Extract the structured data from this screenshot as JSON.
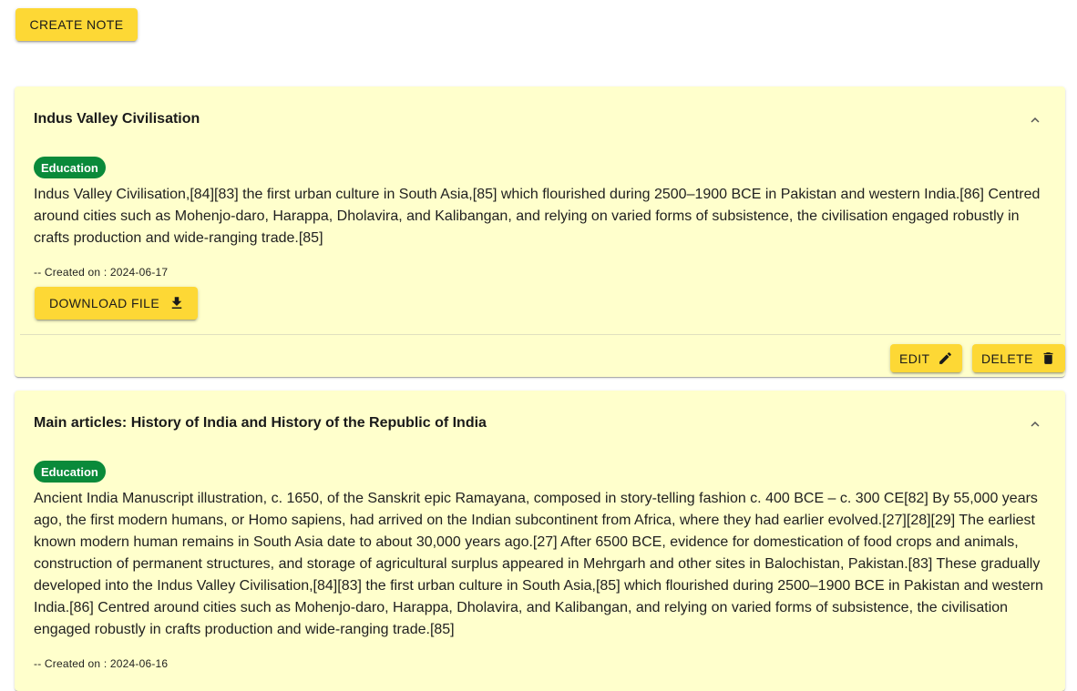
{
  "toolbar": {
    "create_label": "CREATE NOTE"
  },
  "notes": [
    {
      "title": "Indus Valley Civilisation",
      "tag": "Education",
      "body": "Indus Valley Civilisation,[84][83] the first urban culture in South Asia,[85] which flourished during 2500–1900 BCE in Pakistan and western India.[86] Centred around cities such as Mohenjo-daro, Harappa, Dholavira, and Kalibangan, and relying on varied forms of subsistence, the civilisation engaged robustly in crafts production and wide-ranging trade.[85]",
      "created": "-- Created on : 2024-06-17",
      "download_label": "DOWNLOAD FILE",
      "edit_label": "EDIT",
      "delete_label": "DELETE"
    },
    {
      "title": "Main articles: History of India and History of the Republic of India",
      "tag": "Education",
      "body": "Ancient India Manuscript illustration, c. 1650, of the Sanskrit epic Ramayana, composed in story-telling fashion c. 400 BCE – c. 300 CE[82] By 55,000 years ago, the first modern humans, or Homo sapiens, had arrived on the Indian subcontinent from Africa, where they had earlier evolved.[27][28][29] The earliest known modern human remains in South Asia date to about 30,000 years ago.[27] After 6500 BCE, evidence for domestication of food crops and animals, construction of permanent structures, and storage of agricultural surplus appeared in Mehrgarh and other sites in Balochistan, Pakistan.[83] These gradually developed into the Indus Valley Civilisation,[84][83] the first urban culture in South Asia,[85] which flourished during 2500–1900 BCE in Pakistan and western India.[86] Centred around cities such as Mohenjo-daro, Harappa, Dholavira, and Kalibangan, and relying on varied forms of subsistence, the civilisation engaged robustly in crafts production and wide-ranging trade.[85]",
      "created": "-- Created on : 2024-06-16"
    }
  ],
  "icons": {
    "chevron": "chevron-up-icon",
    "download": "download-icon",
    "edit": "pencil-icon",
    "delete": "trash-icon"
  },
  "colors": {
    "accent": "#fdd835",
    "card_bg": "#ffffcc",
    "tag_bg": "#0a8a3a"
  }
}
